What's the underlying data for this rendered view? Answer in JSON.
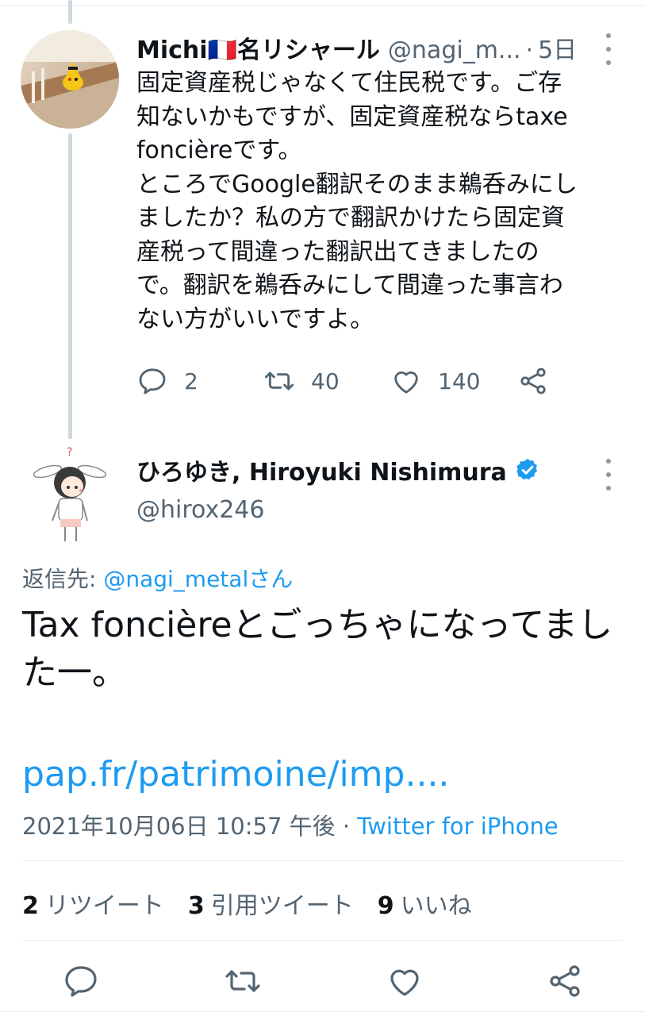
{
  "tweet1": {
    "display_name": "Michi🇫🇷名リシャール",
    "handle": "@nagi_m...",
    "time": "5日",
    "text": "固定資産税じゃなくて住民税です。ご存\n知ないかもですが、固定資産税ならtaxe\nfoncièreです。\nところでGoogle翻訳そのまま鵜呑みにし\nましたか？私の方で翻訳かけたら固定資\n産税って間違った翻訳出てきましたの\nで。翻訳を鵜呑みにして間違った事言わ\nない方がいいですよ。",
    "reply_count": "2",
    "retweet_count": "40",
    "like_count": "140"
  },
  "tweet2": {
    "display_name": "ひろゆき, Hiroyuki Nishimura",
    "handle": "@hirox246",
    "reply_to_prefix": "返信先: ",
    "reply_to_mention": "@nagi_metalさん",
    "text": "Tax foncièreとごっちゃになってました一。",
    "link": "pap.fr/patrimoine/imp....",
    "timestamp": "2021年10月06日 10:57 午後",
    "separator": " · ",
    "source": "Twitter for iPhone",
    "stats": [
      {
        "count": "2",
        "label": "リツイート"
      },
      {
        "count": "3",
        "label": "引用ツイート"
      },
      {
        "count": "9",
        "label": "いいね"
      }
    ]
  },
  "colors": {
    "accent": "#1d9bf0",
    "secondary_text": "#536471",
    "divider": "#e6ecf0"
  },
  "icons": [
    "more-icon",
    "reply-icon",
    "retweet-icon",
    "like-icon",
    "share-icon",
    "verified-badge-icon"
  ]
}
